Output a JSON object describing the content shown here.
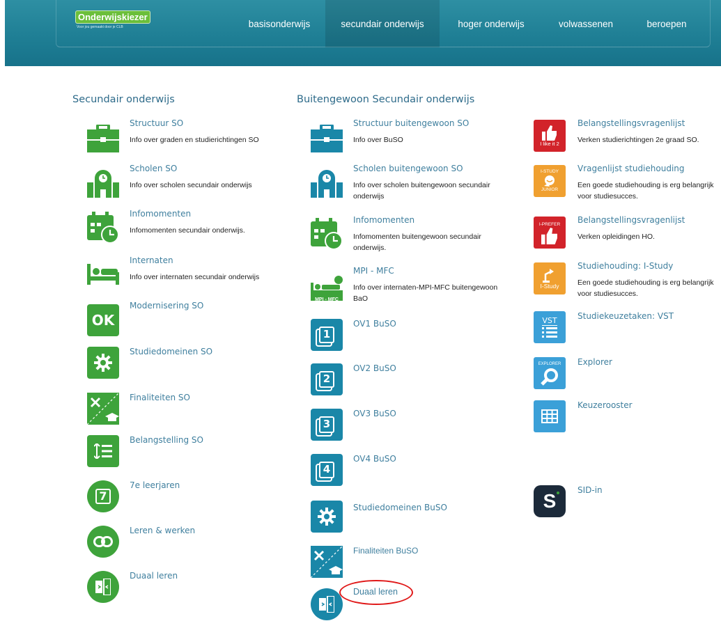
{
  "header": {
    "logo_title": "Onderwijskiezer",
    "logo_subtitle": "Voor jou gemaakt door je CLB",
    "nav": [
      {
        "label": "basisonderwijs",
        "active": false
      },
      {
        "label": "secundair onderwijs",
        "active": true
      },
      {
        "label": "hoger onderwijs",
        "active": false
      },
      {
        "label": "volwassenen",
        "active": false
      },
      {
        "label": "beroepen",
        "active": false
      }
    ],
    "accent_color": "#1f7f95"
  },
  "col1": {
    "heading": "Secundair onderwijs",
    "items": [
      {
        "title": "Structuur SO",
        "desc": "Info over graden en studierichtingen SO",
        "icon": "briefcase-icon"
      },
      {
        "title": "Scholen SO",
        "desc": "Info over scholen secundair onderwijs",
        "icon": "school-building-icon"
      },
      {
        "title": "Infomomenten",
        "desc": "Infomomenten secundair onderwijs.",
        "icon": "calendar-clock-icon"
      },
      {
        "title": "Internaten",
        "desc": "Info over internaten secundair onderwijs",
        "icon": "bed-icon"
      },
      {
        "title": "Modernisering SO",
        "desc": "",
        "icon": "ok-icon",
        "icon_text": "OK"
      },
      {
        "title": "Studiedomeinen SO",
        "desc": "",
        "icon": "gear-icon"
      },
      {
        "title": "Finaliteiten SO",
        "desc": "",
        "icon": "tools-graduation-icon"
      },
      {
        "title": "Belangstelling SO",
        "desc": "",
        "icon": "sort-list-icon"
      },
      {
        "title": "7e leerjaren",
        "desc": "",
        "icon": "number-seven-icon",
        "icon_text": "7"
      },
      {
        "title": "Leren & werken",
        "desc": "",
        "icon": "link-icon"
      },
      {
        "title": "Duaal leren",
        "desc": "",
        "icon": "dual-book-icon"
      }
    ]
  },
  "col2": {
    "heading": "Buitengewoon Secundair onderwijs",
    "items": [
      {
        "title": "Structuur buitengewoon SO",
        "desc": "Info over BuSO",
        "icon": "briefcase-icon"
      },
      {
        "title": "Scholen buitengewoon SO",
        "desc": "Info over scholen buitengewoon secundair onderwijs",
        "icon": "school-building-icon"
      },
      {
        "title": "Infomomenten",
        "desc": "Infomomenten buitengewoon secundair onderwijs.",
        "icon": "calendar-clock-icon"
      },
      {
        "title": "MPI - MFC",
        "desc": "Info over internaten-MPI-MFC buitengewoon BaO",
        "icon": "mpi-mfc-icon",
        "icon_text": "MPI - MFC"
      },
      {
        "title": "OV1 BuSO",
        "desc": "",
        "icon": "ov1-icon",
        "icon_text": "1"
      },
      {
        "title": "OV2 BuSO",
        "desc": "",
        "icon": "ov2-icon",
        "icon_text": "2"
      },
      {
        "title": "OV3 BuSO",
        "desc": "",
        "icon": "ov3-icon",
        "icon_text": "3"
      },
      {
        "title": "OV4 BuSO",
        "desc": "",
        "icon": "ov4-icon",
        "icon_text": "4"
      },
      {
        "title": "Studiedomeinen BuSO",
        "desc": "",
        "icon": "gear-icon"
      },
      {
        "title": "Finaliteiten BuSO",
        "desc": "",
        "icon": "tools-graduation-icon"
      },
      {
        "title": "Duaal leren",
        "desc": "",
        "icon": "dual-book-icon"
      }
    ]
  },
  "col3": {
    "items": [
      {
        "title": "Belangstellingsvragenlijst",
        "desc": "Verken studierichtingen 2e graad SO.",
        "icon": "i-like-it-2-icon",
        "icon_text": "I like it 2"
      },
      {
        "title": "Vragenlijst studiehouding",
        "desc": "Een goede studiehouding is erg belangrijk voor studiesucces.",
        "icon": "i-study-junior-icon",
        "icon_text_top": "I-STUDY",
        "icon_text_bottom": "JUNIOR"
      },
      {
        "title": "Belangstellingsvragenlijst",
        "desc": "Verken opleidingen HO.",
        "icon": "i-prefer-icon",
        "icon_text": "I-PREFER"
      },
      {
        "title": "Studiehouding: I-Study",
        "desc": "Een goede studiehouding is erg belangrijk voor studiesucces.",
        "icon": "i-study-icon",
        "icon_text": "I-Study"
      },
      {
        "title": "Studiekeuzetaken: VST",
        "desc": "",
        "icon": "vst-icon",
        "icon_text": "VST"
      },
      {
        "title": "Explorer",
        "desc": "",
        "icon": "explorer-icon",
        "icon_text": "EXPLORER"
      },
      {
        "title": "Keuzerooster",
        "desc": "",
        "icon": "grid-icon"
      },
      {
        "title": "SID-in",
        "desc": "",
        "icon": "sid-in-icon",
        "icon_text": "S"
      }
    ]
  }
}
